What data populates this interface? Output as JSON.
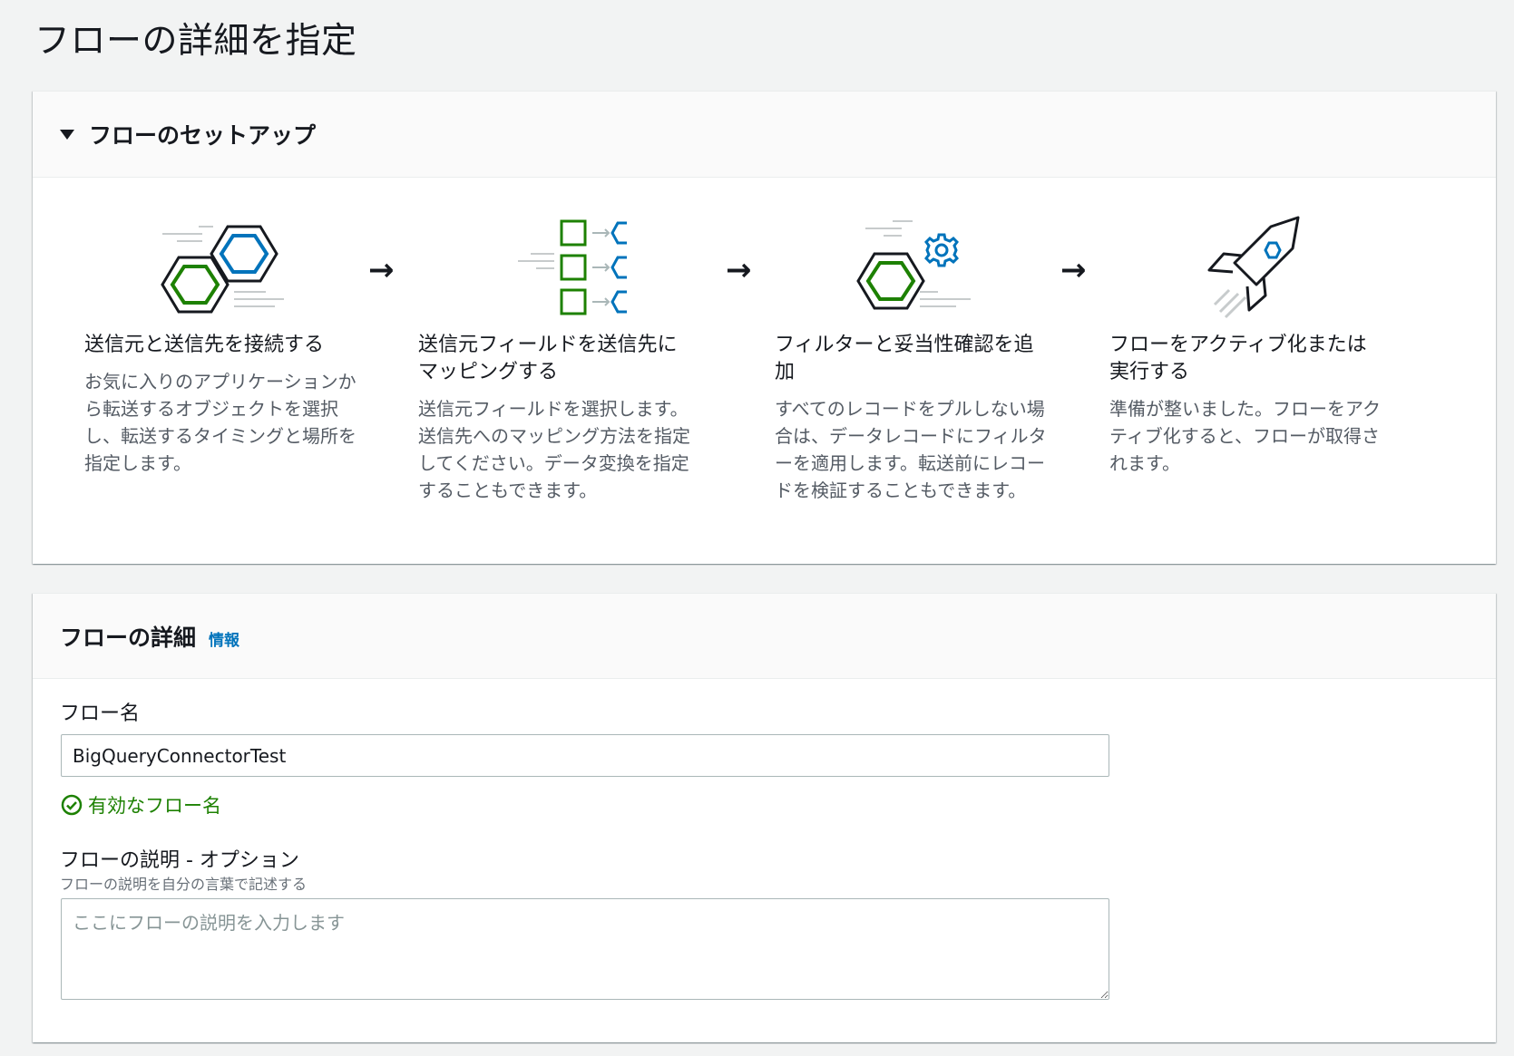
{
  "page": {
    "title": "フローの詳細を指定"
  },
  "setup": {
    "title": "フローのセットアップ",
    "steps": [
      {
        "icon": "connect-hexagons-icon",
        "title": "送信元と送信先を接続する",
        "description": "お気に入りのアプリケーションから転送するオブジェクトを選択し、転送するタイミングと場所を指定します。"
      },
      {
        "icon": "field-mapping-icon",
        "title": "送信元フィールドを送信先にマッピングする",
        "description": "送信元フィールドを選択します。送信先へのマッピング方法を指定してください。データ変換を指定することもできます。"
      },
      {
        "icon": "filter-gear-icon",
        "title": "フィルターと妥当性確認を追加",
        "description": "すべてのレコードをプルしない場合は、データレコードにフィルターを適用します。転送前にレコードを検証することもできます。"
      },
      {
        "icon": "rocket-icon",
        "title": "フローをアクティブ化または実行する",
        "description": "準備が整いました。フローをアクティブ化すると、フローが取得されます。"
      }
    ],
    "arrow": "→"
  },
  "details": {
    "title": "フローの詳細",
    "info_link": "情報",
    "flow_name_label": "フロー名",
    "flow_name_value": "BigQueryConnectorTest",
    "valid_message": "有効なフロー名",
    "description_label": "フローの説明 - オプション",
    "description_hint": "フローの説明を自分の言葉で記述する",
    "description_placeholder": "ここにフローの説明を入力します"
  },
  "colors": {
    "green": "#1d8102",
    "blue": "#0073bb",
    "dark": "#16191f"
  }
}
